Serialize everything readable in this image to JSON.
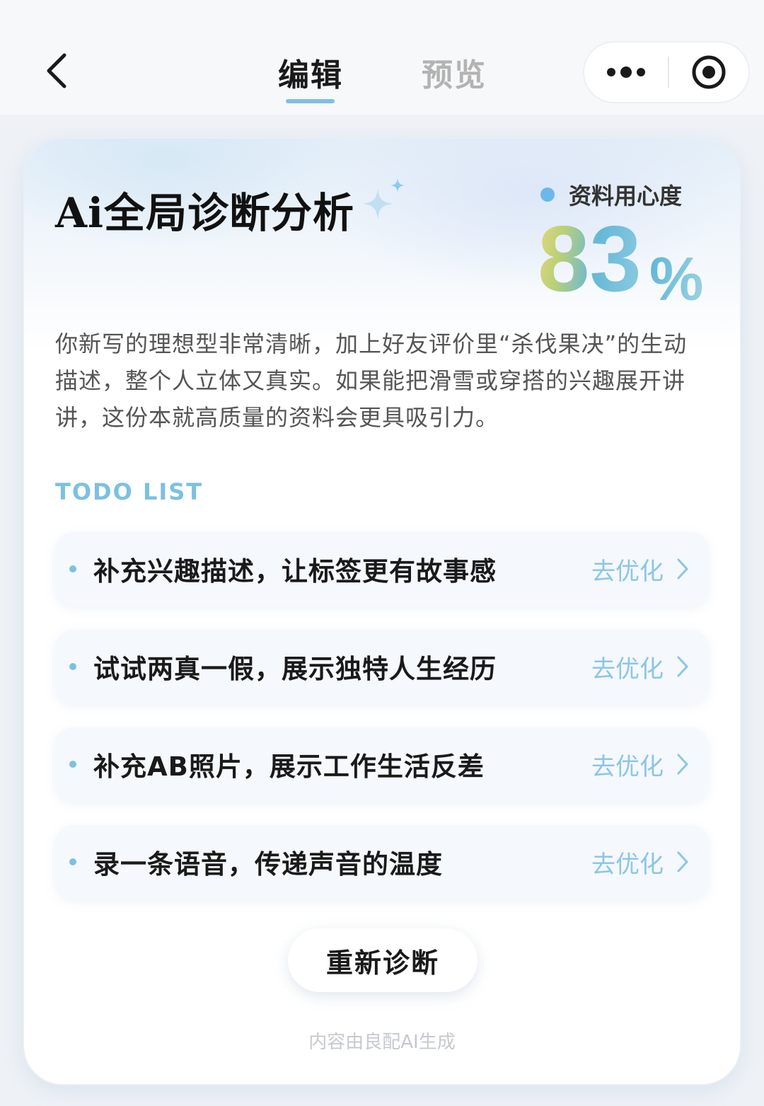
{
  "header": {
    "tabs": [
      {
        "label": "编辑",
        "active": true
      },
      {
        "label": "预览",
        "active": false
      }
    ],
    "back_icon": "chevron-left-icon",
    "more_icon": "more-dots-icon",
    "target_icon": "target-icon"
  },
  "card": {
    "title": "Ai全局诊断分析",
    "score_label": "资料用心度",
    "score_value": "83",
    "score_unit": "%",
    "description": "你新写的理想型非常清晰，加上好友评价里“杀伐果决”的生动描述，整个人立体又真实。如果能把滑雪或穿搭的兴趣展开讲讲，这份本就高质量的资料会更具吸引力。",
    "todo_heading": "TODO LIST",
    "todos": [
      {
        "text": "补充兴趣描述，让标签更有故事感",
        "action": "去优化"
      },
      {
        "text": "试试两真一假，展示独特人生经历",
        "action": "去优化"
      },
      {
        "text": "补充AB照片，展示工作生活反差",
        "action": "去优化"
      },
      {
        "text": "录一条语音，传递声音的温度",
        "action": "去优化"
      }
    ],
    "rediagnose_label": "重新诊断",
    "footnote": "内容由良配AI生成"
  },
  "colors": {
    "accent": "#7fc0e2",
    "todo_action": "#8cc6e4",
    "score_gradient_start": "#e6d977",
    "score_gradient_end": "#66b8d8"
  }
}
